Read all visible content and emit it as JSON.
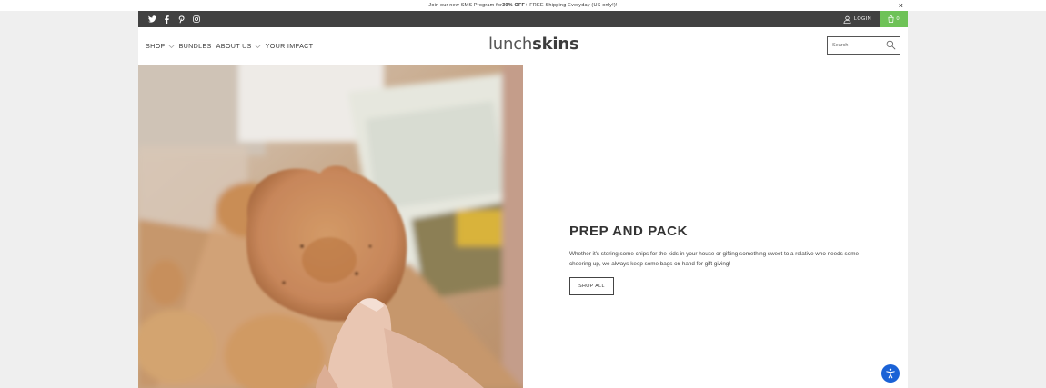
{
  "announcement": {
    "text_pre": "Join our new SMS Program for ",
    "text_bold": "30% OFF",
    "text_post": " + FREE Shipping Everyday (US only!)!",
    "close": "×"
  },
  "topbar": {
    "socials": [
      "twitter-icon",
      "facebook-icon",
      "pinterest-icon",
      "instagram-icon"
    ],
    "login_label": "LOGIN",
    "cart_count": "0",
    "cart_color": "#6ec257",
    "bar_color": "#414141"
  },
  "nav": {
    "items": [
      {
        "label": "SHOP",
        "has_dropdown": true
      },
      {
        "label": "BUNDLES",
        "has_dropdown": false
      },
      {
        "label": "ABOUT US",
        "has_dropdown": true
      },
      {
        "label": "YOUR IMPACT",
        "has_dropdown": false
      }
    ]
  },
  "logo": {
    "part1": "lunch",
    "part2": "skins"
  },
  "search": {
    "placeholder": "Search"
  },
  "hero": {
    "title": "PREP AND PACK",
    "body": "Whether it's storing some chips for the kids in your house or gifting something sweet to a relative who needs some cheering up, we always keep some bags on hand for gift giving!",
    "button_label": "SHOP ALL"
  },
  "accessibility": {
    "icon": "accessibility-icon",
    "color": "#1a62d6"
  }
}
